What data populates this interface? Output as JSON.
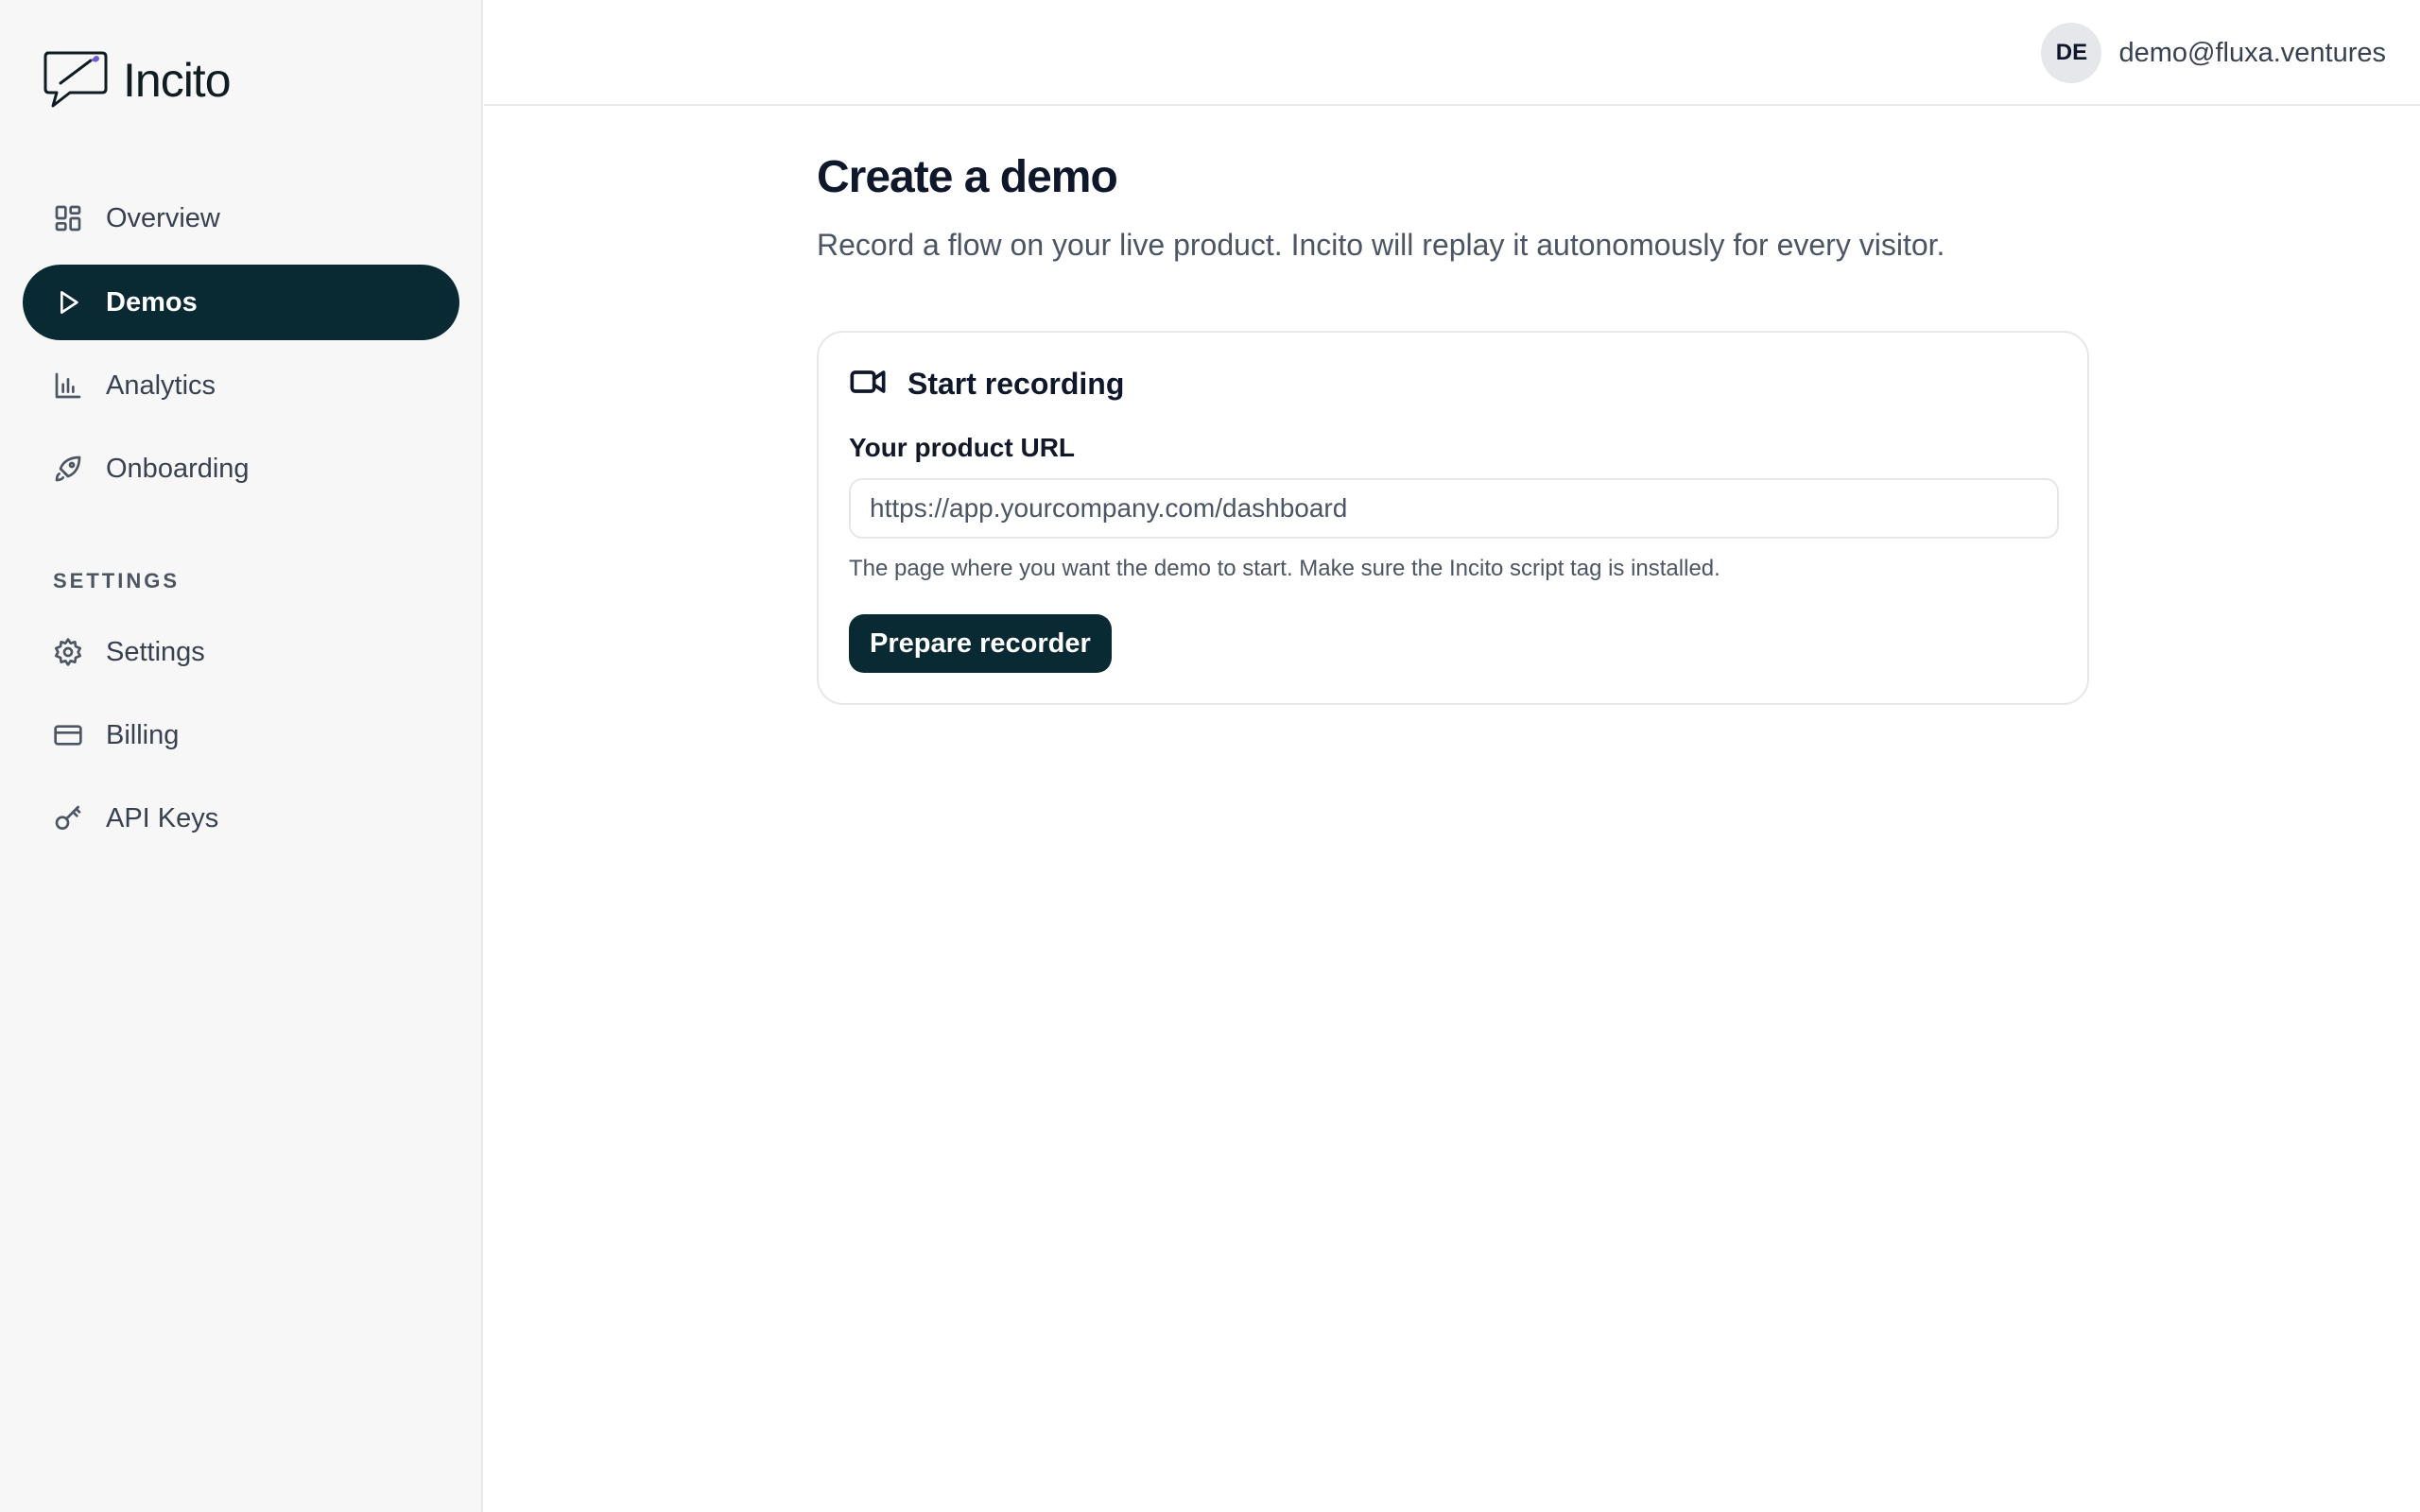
{
  "brand": {
    "name": "Incito",
    "accent": "#0a2a33"
  },
  "sidebar": {
    "nav": [
      {
        "label": "Overview",
        "icon": "layout-grid-icon",
        "active": false
      },
      {
        "label": "Demos",
        "icon": "play-icon",
        "active": true
      },
      {
        "label": "Analytics",
        "icon": "bar-chart-icon",
        "active": false
      },
      {
        "label": "Onboarding",
        "icon": "rocket-icon",
        "active": false
      }
    ],
    "settings_section_label": "SETTINGS",
    "settings": [
      {
        "label": "Settings",
        "icon": "gear-icon"
      },
      {
        "label": "Billing",
        "icon": "credit-card-icon"
      },
      {
        "label": "API Keys",
        "icon": "key-icon"
      }
    ]
  },
  "header": {
    "user": {
      "initials": "DE",
      "email": "demo@fluxa.ventures"
    }
  },
  "main": {
    "title": "Create a demo",
    "subtitle": "Record a flow on your live product. Incito will replay it autonomously for every visitor.",
    "card": {
      "title": "Start recording",
      "url_label": "Your product URL",
      "url_placeholder": "https://app.yourcompany.com/dashboard",
      "url_value": "",
      "hint": "The page where you want the demo to start. Make sure the Incito script tag is installed.",
      "button_label": "Prepare recorder"
    }
  }
}
